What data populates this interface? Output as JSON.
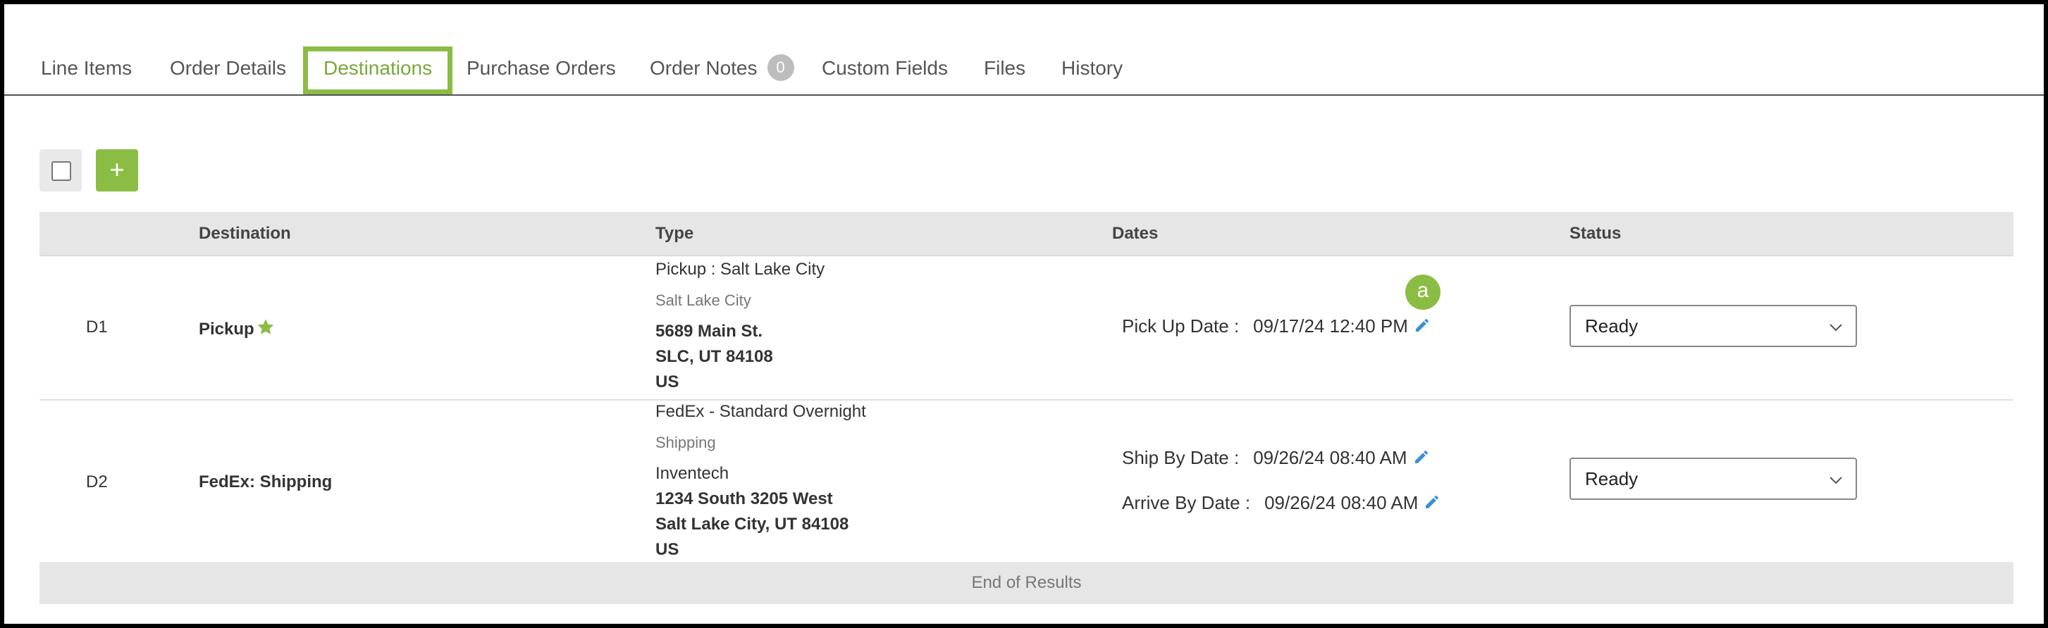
{
  "tabs": [
    {
      "label": "Line Items"
    },
    {
      "label": "Order Details"
    },
    {
      "label": "Destinations"
    },
    {
      "label": "Purchase Orders"
    },
    {
      "label": "Order Notes",
      "badge": "0"
    },
    {
      "label": "Custom Fields"
    },
    {
      "label": "Files"
    },
    {
      "label": "History"
    }
  ],
  "toolbar": {
    "add_label": "+"
  },
  "table": {
    "headers": {
      "destination": "Destination",
      "type": "Type",
      "dates": "Dates",
      "status": "Status"
    },
    "rows": [
      {
        "code": "D1",
        "destination": "Pickup",
        "type_title": "Pickup : Salt Lake City",
        "type_sub": "Salt Lake City",
        "address": [
          "5689 Main St.",
          "SLC, UT 84108",
          "US"
        ],
        "dates": [
          {
            "label": "Pick Up Date :",
            "value": "09/17/24 12:40 PM"
          }
        ],
        "status": "Ready"
      },
      {
        "code": "D2",
        "destination": "FedEx: Shipping",
        "type_title": "FedEx - Standard Overnight",
        "type_sub": "Shipping",
        "address_name": "Inventech",
        "address": [
          "1234 South 3205 West",
          "Salt Lake City, UT 84108",
          "US"
        ],
        "dates": [
          {
            "label": "Ship By Date :",
            "value": "09/26/24 08:40 AM"
          },
          {
            "label": "Arrive By Date :",
            "value": "09/26/24 08:40 AM"
          }
        ],
        "status": "Ready"
      }
    ],
    "footer": "End of Results"
  },
  "annotation": {
    "marker": "a"
  },
  "colors": {
    "accent": "#8bbd45",
    "accent_text": "#7aa83a",
    "pencil": "#3d8fd6",
    "header_bg": "#e6e6e6"
  }
}
